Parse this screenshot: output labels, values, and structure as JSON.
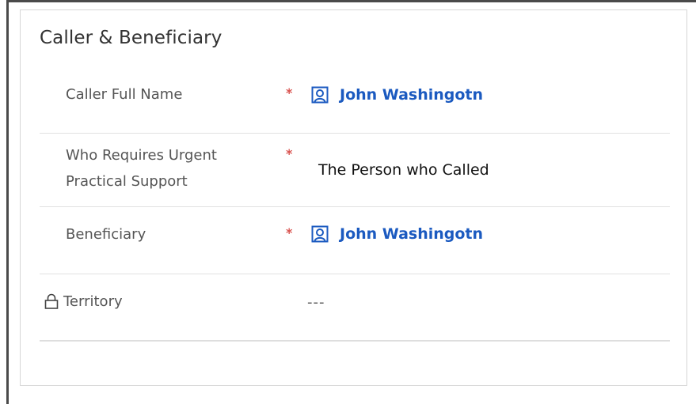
{
  "section": {
    "title": "Caller & Beneficiary"
  },
  "fields": {
    "caller_full_name": {
      "label": "Caller Full Name",
      "required_marker": "*",
      "value": "John Washingotn",
      "icon": "contact-lookup-icon"
    },
    "urgent_support": {
      "label": "Who Requires Urgent Practical Support",
      "required_marker": "*",
      "value": "The Person who Called"
    },
    "beneficiary": {
      "label": "Beneficiary",
      "required_marker": "*",
      "value": "John Washingotn",
      "icon": "contact-lookup-icon"
    },
    "territory": {
      "label": "Territory",
      "value": "---",
      "icon": "lock-icon"
    }
  },
  "colors": {
    "link": "#1b5ac0",
    "required": "#d9534f",
    "label": "#555555",
    "divider": "#e1e1e1"
  }
}
